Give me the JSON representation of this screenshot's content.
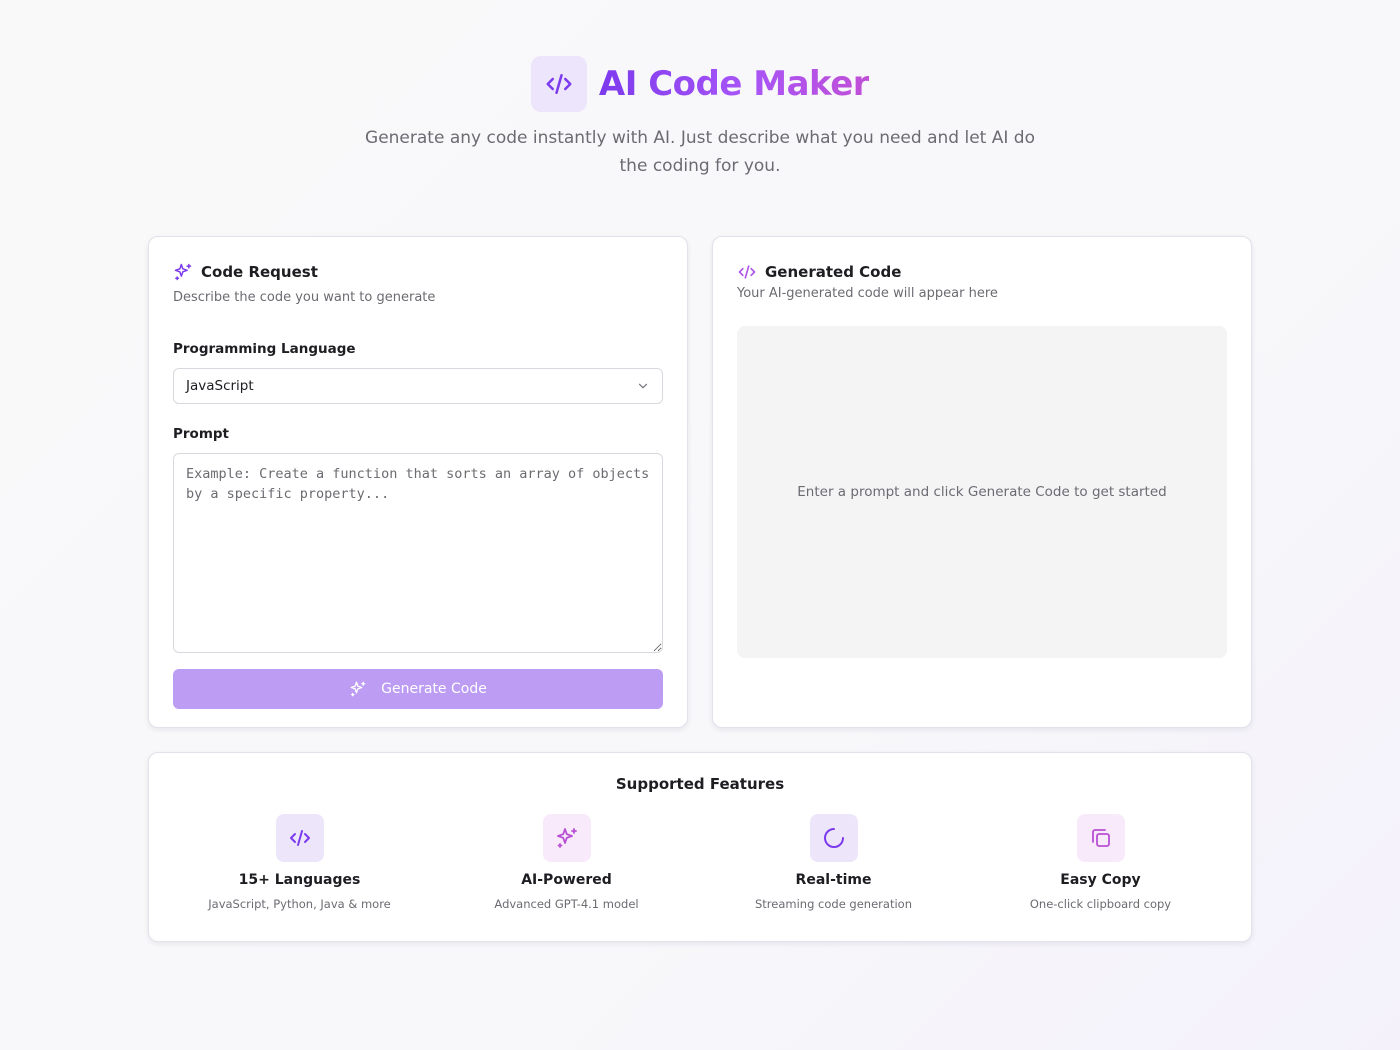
{
  "app": {
    "title": "AI Code Maker",
    "subtitle": "Generate any code instantly with AI. Just describe what you need and let AI do the coding for you."
  },
  "colors": {
    "accent": "#7c3aed",
    "accent_light": "#a855f7",
    "pink": "#c04fd6",
    "button_disabled": "#bd9cf3"
  },
  "request": {
    "title": "Code Request",
    "icon": "sparkles-icon",
    "description": "Describe the code you want to generate",
    "language_label": "Programming Language",
    "language_value": "JavaScript",
    "prompt_label": "Prompt",
    "prompt_placeholder": "Example: Create a function that sorts an array of objects by a specific property...",
    "prompt_value": "",
    "generate_label": "Generate Code"
  },
  "output": {
    "title": "Generated Code",
    "icon": "code-icon",
    "description": "Your AI-generated code will appear here",
    "empty_message": "Enter a prompt and click Generate Code to get started"
  },
  "features": {
    "title": "Supported Features",
    "items": [
      {
        "icon": "code-icon",
        "name": "15+ Languages",
        "desc": "JavaScript, Python, Java & more"
      },
      {
        "icon": "sparkles-icon",
        "name": "AI-Powered",
        "desc": "Advanced GPT-4.1 model"
      },
      {
        "icon": "loader-icon",
        "name": "Real-time",
        "desc": "Streaming code generation"
      },
      {
        "icon": "copy-icon",
        "name": "Easy Copy",
        "desc": "One-click clipboard copy"
      }
    ]
  }
}
